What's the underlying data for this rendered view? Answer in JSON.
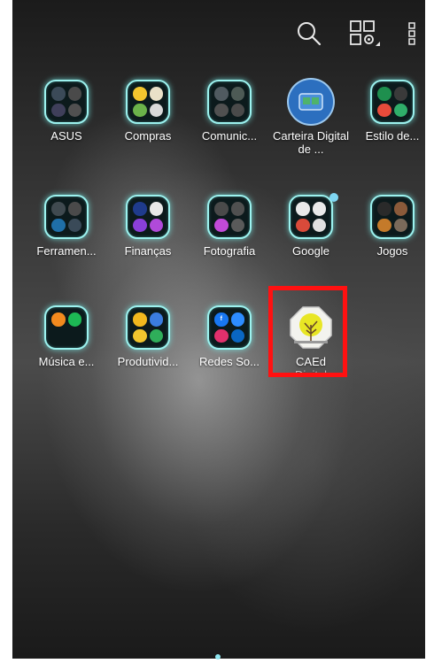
{
  "topbar": {
    "icons": [
      "search-icon",
      "widgets-settings-icon",
      "more-vert-icon"
    ]
  },
  "apps": [
    {
      "id": "asus",
      "label": "ASUS",
      "type": "folder"
    },
    {
      "id": "compras",
      "label": "Compras",
      "type": "folder"
    },
    {
      "id": "comunic",
      "label": "Comunic...",
      "type": "folder"
    },
    {
      "id": "carteira",
      "label": "Carteira Digital de ...",
      "type": "app"
    },
    {
      "id": "estilo",
      "label": "Estilo de...",
      "type": "folder"
    },
    {
      "id": "ferramen",
      "label": "Ferramen...",
      "type": "folder"
    },
    {
      "id": "financas",
      "label": "Finanças",
      "type": "folder"
    },
    {
      "id": "fotografia",
      "label": "Fotografia",
      "type": "folder"
    },
    {
      "id": "google",
      "label": "Google",
      "type": "folder"
    },
    {
      "id": "jogos",
      "label": "Jogos",
      "type": "folder"
    },
    {
      "id": "musica",
      "label": "Música e...",
      "type": "folder"
    },
    {
      "id": "produtivid",
      "label": "Produtivid...",
      "type": "folder"
    },
    {
      "id": "redes",
      "label": "Redes So...",
      "type": "folder"
    },
    {
      "id": "caed",
      "label": "CAEd",
      "sublabel": "Digital",
      "type": "app"
    }
  ],
  "colors": {
    "folder_glow": "#9cf2ef",
    "highlight": "#ff1111",
    "page_indicator": "#8fe6f0"
  }
}
